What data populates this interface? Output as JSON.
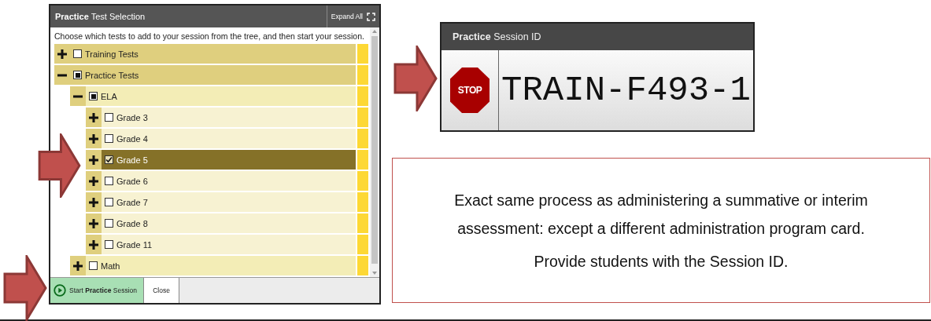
{
  "test_selection": {
    "title": "**Practice** Test Selection",
    "expand_all": "Expand All",
    "instructions": "Choose which tests to add to your session from the tree, and then start your session.",
    "tree": [
      {
        "label": "Training Tests",
        "expanded": false,
        "checked": false,
        "partial": false,
        "selected": false
      },
      {
        "label": "Practice Tests",
        "expanded": true,
        "checked": true,
        "partial": true,
        "selected": false,
        "children": [
          {
            "label": "ELA",
            "expanded": true,
            "checked": true,
            "partial": true,
            "selected": false,
            "children": [
              {
                "label": "Grade 3",
                "expanded": false,
                "checked": false,
                "partial": false,
                "selected": false
              },
              {
                "label": "Grade 4",
                "expanded": false,
                "checked": false,
                "partial": false,
                "selected": false
              },
              {
                "label": "Grade 5",
                "expanded": false,
                "checked": true,
                "partial": false,
                "selected": true
              },
              {
                "label": "Grade 6",
                "expanded": false,
                "checked": false,
                "partial": false,
                "selected": false
              },
              {
                "label": "Grade 7",
                "expanded": false,
                "checked": false,
                "partial": false,
                "selected": false
              },
              {
                "label": "Grade 8",
                "expanded": false,
                "checked": false,
                "partial": false,
                "selected": false
              },
              {
                "label": "Grade 11",
                "expanded": false,
                "checked": false,
                "partial": false,
                "selected": false
              }
            ]
          },
          {
            "label": "Math",
            "expanded": false,
            "checked": false,
            "partial": false,
            "selected": false
          }
        ]
      }
    ],
    "start_button": "Start **Practice** Session",
    "close_button": "Close"
  },
  "session_card": {
    "title": "**Practice** Session ID",
    "stop_label": "STOP",
    "session_id": "TRAIN-F493-1"
  },
  "note": {
    "paragraphs": [
      "Exact same process as administering a summative or interim assessment: except a different administration program card.",
      "Provide students with the Session ID."
    ]
  }
}
